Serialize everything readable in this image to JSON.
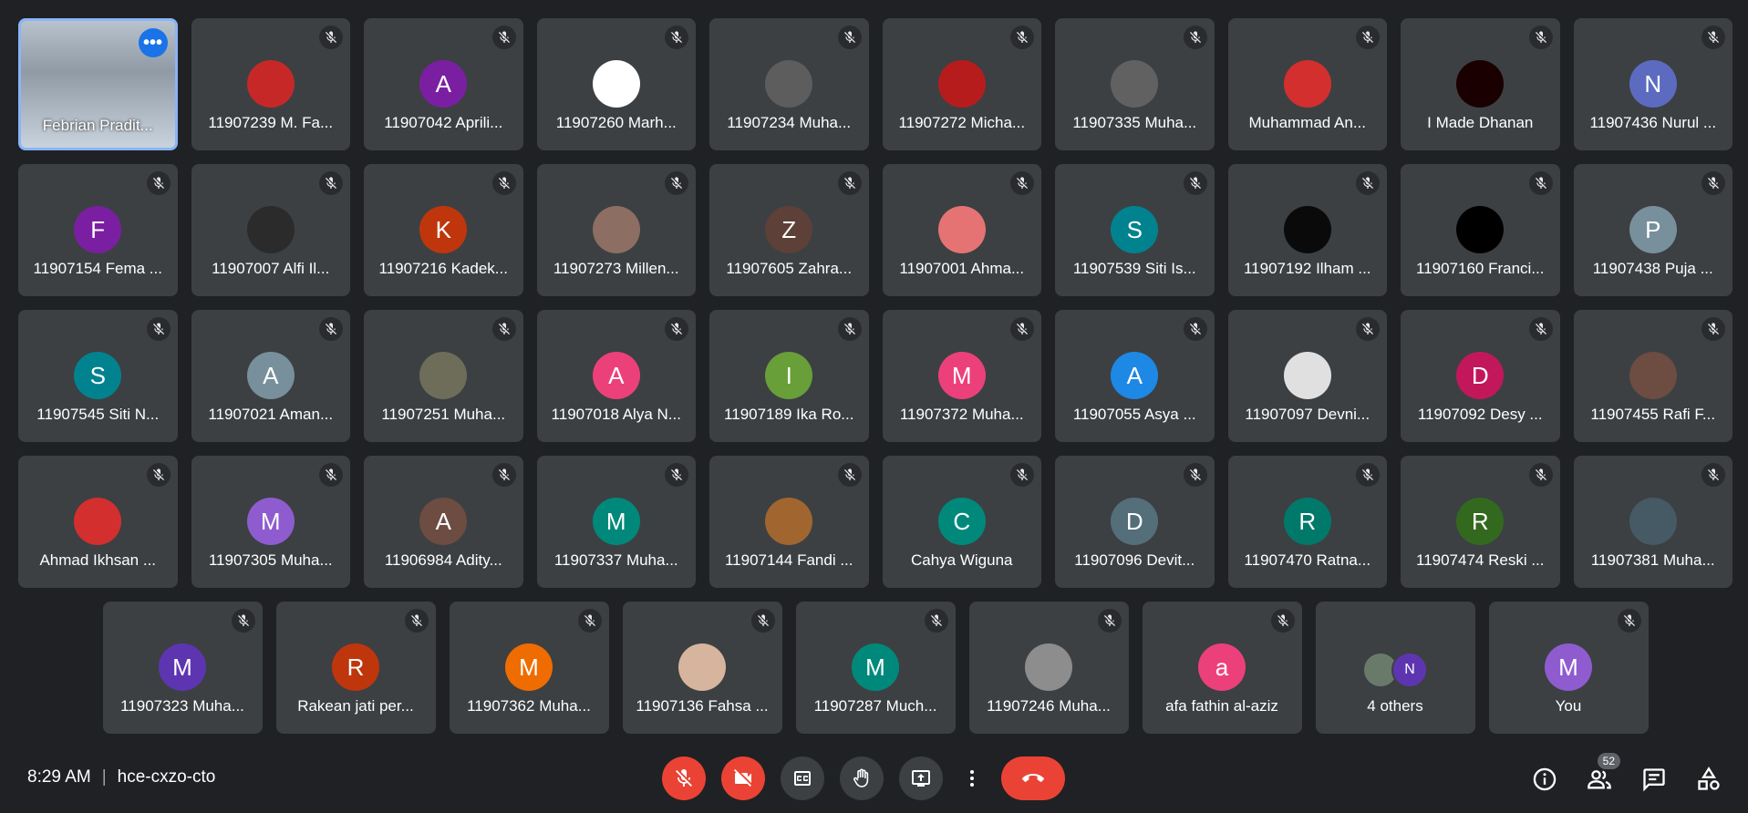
{
  "self_tile": {
    "name": "Febrian Pradit..."
  },
  "rows": [
    [
      {
        "name": "11907239 M. Fa...",
        "initial": "",
        "color": "#c62828",
        "photo": true
      },
      {
        "name": "11907042 Aprili...",
        "initial": "A",
        "color": "#7b1fa2"
      },
      {
        "name": "11907260 Marh...",
        "initial": "",
        "color": "#ffffff",
        "photo": true
      },
      {
        "name": "11907234 Muha...",
        "initial": "",
        "color": "#5d5d5d",
        "photo": true
      },
      {
        "name": "11907272 Micha...",
        "initial": "",
        "color": "#b71c1c",
        "photo": true
      },
      {
        "name": "11907335 Muha...",
        "initial": "",
        "color": "#616161",
        "photo": true
      },
      {
        "name": "Muhammad An...",
        "initial": "",
        "color": "#d32f2f",
        "photo": true
      },
      {
        "name": "I Made Dhanan",
        "initial": "",
        "color": "#1a0000",
        "photo": true
      },
      {
        "name": "11907436 Nurul ...",
        "initial": "N",
        "color": "#5c6bc0"
      }
    ],
    [
      {
        "name": "11907154 Fema ...",
        "initial": "F",
        "color": "#7b1fa2"
      },
      {
        "name": "11907007 Alfi Il...",
        "initial": "",
        "color": "#2b2b2b",
        "photo": true
      },
      {
        "name": "11907216 Kadek...",
        "initial": "K",
        "color": "#bf360c"
      },
      {
        "name": "11907273 Millen...",
        "initial": "",
        "color": "#8d6e63",
        "photo": true
      },
      {
        "name": "11907605 Zahra...",
        "initial": "Z",
        "color": "#5d4037"
      },
      {
        "name": "11907001 Ahma...",
        "initial": "",
        "color": "#e57373",
        "photo": true
      },
      {
        "name": "11907539 Siti Is...",
        "initial": "S",
        "color": "#00838f"
      },
      {
        "name": "11907192 Ilham ...",
        "initial": "",
        "color": "#0a0a0a",
        "photo": true
      },
      {
        "name": "11907160 Franci...",
        "initial": "",
        "color": "#000000",
        "photo": true
      },
      {
        "name": "11907438 Puja ...",
        "initial": "P",
        "color": "#78909c"
      }
    ],
    [
      {
        "name": "11907545 Siti N...",
        "initial": "S",
        "color": "#00838f"
      },
      {
        "name": "11907021 Aman...",
        "initial": "A",
        "color": "#78909c"
      },
      {
        "name": "11907251 Muha...",
        "initial": "",
        "color": "#6d6d5a",
        "photo": true
      },
      {
        "name": "11907018 Alya N...",
        "initial": "A",
        "color": "#ec407a"
      },
      {
        "name": "11907189 Ika Ro...",
        "initial": "I",
        "color": "#689f38"
      },
      {
        "name": "11907372 Muha...",
        "initial": "M",
        "color": "#ec407a"
      },
      {
        "name": "11907055 Asya ...",
        "initial": "A",
        "color": "#1e88e5"
      },
      {
        "name": "11907097 Devni...",
        "initial": "",
        "color": "#e0e0e0",
        "photo": true
      },
      {
        "name": "11907092 Desy ...",
        "initial": "D",
        "color": "#c2185b"
      },
      {
        "name": "11907455 Rafi F...",
        "initial": "",
        "color": "#6d4c41",
        "photo": true
      }
    ],
    [
      {
        "name": "Ahmad Ikhsan ...",
        "initial": "",
        "color": "#d32f2f",
        "photo": true
      },
      {
        "name": "11907305 Muha...",
        "initial": "M",
        "color": "#8e5ccf"
      },
      {
        "name": "11906984 Adity...",
        "initial": "A",
        "color": "#6d4c41"
      },
      {
        "name": "11907337 Muha...",
        "initial": "M",
        "color": "#00897b"
      },
      {
        "name": "11907144 Fandi ...",
        "initial": "",
        "color": "#a1662f",
        "photo": true
      },
      {
        "name": "Cahya Wiguna",
        "initial": "C",
        "color": "#00897b"
      },
      {
        "name": "11907096 Devit...",
        "initial": "D",
        "color": "#546e7a"
      },
      {
        "name": "11907470 Ratna...",
        "initial": "R",
        "color": "#00796b"
      },
      {
        "name": "11907474 Reski ...",
        "initial": "R",
        "color": "#33691e"
      },
      {
        "name": "11907381 Muha...",
        "initial": "",
        "color": "#455a64",
        "photo": true
      }
    ],
    [
      {
        "name": "11907323 Muha...",
        "initial": "M",
        "color": "#5e35b1"
      },
      {
        "name": "Rakean jati per...",
        "initial": "R",
        "color": "#bf360c"
      },
      {
        "name": "11907362 Muha...",
        "initial": "M",
        "color": "#ef6c00"
      },
      {
        "name": "11907136 Fahsa ...",
        "initial": "",
        "color": "#d7b49e",
        "photo": true
      },
      {
        "name": "11907287 Much...",
        "initial": "M",
        "color": "#00897b"
      },
      {
        "name": "11907246 Muha...",
        "initial": "",
        "color": "#8d8d8d",
        "photo": true
      },
      {
        "name": "afa fathin al-aziz",
        "initial": "a",
        "color": "#ec407a"
      }
    ]
  ],
  "others_tile": {
    "label": "4 others",
    "avatar_initial": "N",
    "avatar_color": "#5e35b1",
    "photo_color": "#6a7a6a"
  },
  "you_tile": {
    "name": "You",
    "initial": "M",
    "color": "#8e5ccf"
  },
  "bottom": {
    "time": "8:29 AM",
    "meeting_code": "hce-cxzo-cto",
    "people_count": "52"
  },
  "colors": {
    "mic_off": "#ea4335",
    "end_call": "#ea4335",
    "self_border": "#8ab4f8"
  }
}
